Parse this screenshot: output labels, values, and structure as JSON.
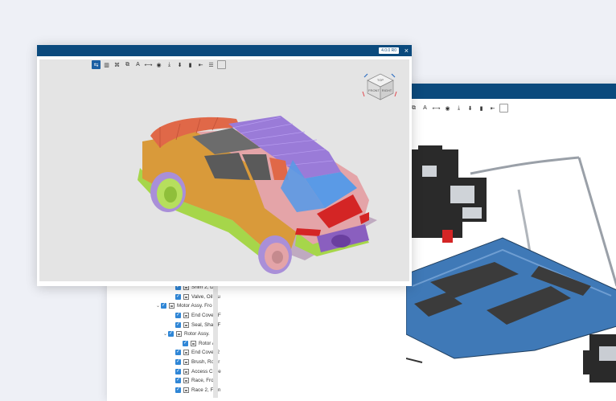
{
  "back_window": {
    "toolbar": [
      "⧉",
      "A",
      "⟷",
      "◉",
      "⤓",
      "⬇",
      "▮",
      "⇤",
      ""
    ],
    "tree": [
      {
        "label": "Shim 2, Diff",
        "indent": 2,
        "chev": "",
        "kind": "part"
      },
      {
        "label": "Valve, Oil Su",
        "indent": 2,
        "chev": "",
        "kind": "part"
      },
      {
        "label": "Motor Assy. Fro",
        "indent": 0,
        "chev": "⌄",
        "kind": "assy"
      },
      {
        "label": "End Cover, F",
        "indent": 2,
        "chev": "",
        "kind": "part"
      },
      {
        "label": "Seal, Shaft F",
        "indent": 2,
        "chev": "",
        "kind": "part"
      },
      {
        "label": "Rotor Assy.",
        "indent": 1,
        "chev": "⌄",
        "kind": "assy"
      },
      {
        "label": "Rotor As",
        "indent": 3,
        "chev": "",
        "kind": "part"
      },
      {
        "label": "End Cover 2",
        "indent": 2,
        "chev": "",
        "kind": "part"
      },
      {
        "label": "Brush, Rotor",
        "indent": 2,
        "chev": "",
        "kind": "part"
      },
      {
        "label": "Access Cove",
        "indent": 2,
        "chev": "",
        "kind": "part"
      },
      {
        "label": "Race, Front",
        "indent": 2,
        "chev": "",
        "kind": "part"
      },
      {
        "label": "Race 2, Fron",
        "indent": 2,
        "chev": "",
        "kind": "part"
      }
    ]
  },
  "front_window": {
    "title_badge": "4.0.0 R0",
    "close_icon": "×",
    "toolbar": [
      "⇆",
      "▥",
      "⌘",
      "⧉",
      "A",
      "⟷",
      "◉",
      "⤓",
      "⬇",
      "▮",
      "⇤",
      "☰",
      ""
    ],
    "viewcube": {
      "top": "TOP",
      "front": "FRONT",
      "right": "RIGHT"
    }
  },
  "colors": {
    "titlebar": "#0b4a7d",
    "accent": "#2f86d6",
    "car_red": "#e06848",
    "car_purple": "#9a7bd8",
    "car_orange": "#d99a3a",
    "car_blue": "#5a9ae6",
    "car_green": "#a6d64a",
    "car_pink": "#e4a4a8",
    "battery_blue": "#3f79b7"
  }
}
